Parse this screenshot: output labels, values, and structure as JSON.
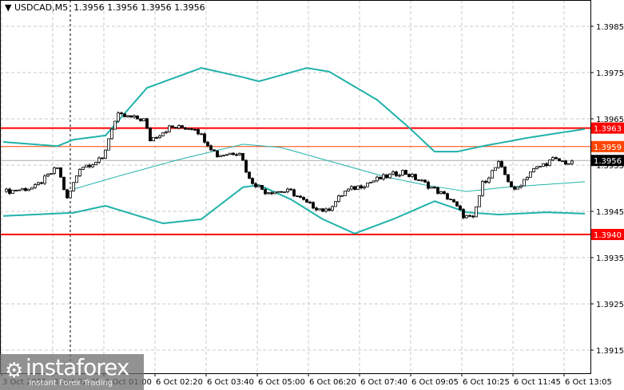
{
  "header": {
    "symbol": "USDCAD,M5",
    "ohlc": "1.3956 1.3956 1.3956 1.3956"
  },
  "logo": {
    "name": "instaforex",
    "tagline": "Instant Forex Trading"
  },
  "colors": {
    "band": "#20b2aa",
    "support": "#ff0000",
    "level": "#ff4500",
    "current": "#000000"
  },
  "chart_data": {
    "type": "candlestick",
    "title": "USDCAD,M5",
    "ylim": [
      1.39089,
      1.3991
    ],
    "y_ticks": [
      "1.3985",
      "1.3975",
      "1.3965",
      "1.3955",
      "1.3945",
      "1.3935",
      "1.3925",
      "1.3915"
    ],
    "x_ticks": [
      "3 Oct 2025",
      "3 Oct 22:35",
      "6 Oct 01:00",
      "6 Oct 02:20",
      "6 Oct 03:40",
      "6 Oct 05:00",
      "6 Oct 06:20",
      "6 Oct 07:40",
      "6 Oct 09:05",
      "6 Oct 10:25",
      "6 Oct 11:45",
      "6 Oct 13:05"
    ],
    "bars_per_tick": 16,
    "close_keypoints": [
      [
        1,
        1.39493
      ],
      [
        10,
        1.39502
      ],
      [
        17,
        1.39545
      ],
      [
        20,
        1.39476
      ],
      [
        24,
        1.39545
      ],
      [
        31,
        1.39562
      ],
      [
        34,
        1.39631
      ],
      [
        36,
        1.39657
      ],
      [
        44,
        1.39648
      ],
      [
        46,
        1.39605
      ],
      [
        52,
        1.39631
      ],
      [
        60,
        1.39631
      ],
      [
        67,
        1.39571
      ],
      [
        74,
        1.39579
      ],
      [
        77,
        1.39519
      ],
      [
        82,
        1.39493
      ],
      [
        90,
        1.39493
      ],
      [
        95,
        1.39467
      ],
      [
        101,
        1.3945
      ],
      [
        107,
        1.39493
      ],
      [
        117,
        1.39519
      ],
      [
        125,
        1.39536
      ],
      [
        132,
        1.3951
      ],
      [
        140,
        1.39476
      ],
      [
        144,
        1.39441
      ],
      [
        147,
        1.39433
      ],
      [
        150,
        1.3951
      ],
      [
        155,
        1.39553
      ],
      [
        160,
        1.39493
      ],
      [
        165,
        1.39536
      ],
      [
        172,
        1.39562
      ],
      [
        178,
        1.39553
      ]
    ],
    "bollinger": {
      "upper": [
        [
          0,
          1.396
        ],
        [
          17,
          1.39591
        ],
        [
          22,
          1.39605
        ],
        [
          32,
          1.39614
        ],
        [
          45,
          1.39717
        ],
        [
          62,
          1.3976
        ],
        [
          75,
          1.3974
        ],
        [
          80,
          1.39731
        ],
        [
          95,
          1.3976
        ],
        [
          102,
          1.39752
        ],
        [
          117,
          1.39691
        ],
        [
          127,
          1.39631
        ],
        [
          135,
          1.39579
        ],
        [
          142,
          1.39579
        ],
        [
          150,
          1.39591
        ],
        [
          165,
          1.3961
        ],
        [
          182,
          1.39628
        ]
      ],
      "middle": [
        [
          22,
          1.39498
        ],
        [
          37,
          1.39528
        ],
        [
          55,
          1.39562
        ],
        [
          75,
          1.39595
        ],
        [
          87,
          1.39588
        ],
        [
          105,
          1.39553
        ],
        [
          120,
          1.39524
        ],
        [
          132,
          1.39507
        ],
        [
          145,
          1.39493
        ],
        [
          157,
          1.39502
        ],
        [
          182,
          1.39514
        ]
      ],
      "lower": [
        [
          0,
          1.3944
        ],
        [
          22,
          1.39447
        ],
        [
          32,
          1.39462
        ],
        [
          50,
          1.39424
        ],
        [
          62,
          1.39433
        ],
        [
          75,
          1.39502
        ],
        [
          80,
          1.39507
        ],
        [
          90,
          1.39476
        ],
        [
          100,
          1.39433
        ],
        [
          110,
          1.39402
        ],
        [
          122,
          1.39433
        ],
        [
          135,
          1.39472
        ],
        [
          145,
          1.39448
        ],
        [
          155,
          1.39443
        ],
        [
          170,
          1.39448
        ],
        [
          182,
          1.39445
        ]
      ]
    },
    "levels": [
      {
        "price": 1.3963,
        "label": "1.3963",
        "kind": "support"
      },
      {
        "price": 1.394,
        "label": "1.3940",
        "kind": "support"
      },
      {
        "price": 1.3959,
        "label": "1.3959",
        "kind": "level"
      },
      {
        "price": 1.3956,
        "label": "1.3956",
        "kind": "current"
      }
    ]
  }
}
